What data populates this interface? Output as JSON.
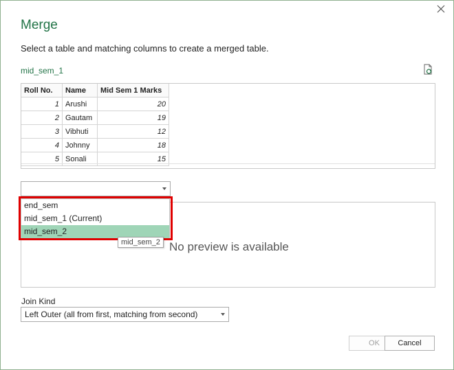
{
  "dialog": {
    "title": "Merge",
    "subtitle": "Select a table and matching columns to create a merged table.",
    "close_icon": "close-icon",
    "refresh_icon": "refresh-icon"
  },
  "first_table": {
    "name": "mid_sem_1",
    "columns": [
      "Roll No.",
      "Name",
      "Mid Sem 1 Marks"
    ],
    "rows": [
      [
        "1",
        "Arushi",
        "20"
      ],
      [
        "2",
        "Gautam",
        "19"
      ],
      [
        "3",
        "Vibhuti",
        "12"
      ],
      [
        "4",
        "Johnny",
        "18"
      ],
      [
        "5",
        "Sonali",
        "15"
      ]
    ]
  },
  "second_table_select": {
    "value": "",
    "options": [
      "end_sem",
      "mid_sem_1 (Current)",
      "mid_sem_2"
    ],
    "highlighted_option": "mid_sem_2",
    "tooltip": "mid_sem_2"
  },
  "second_preview": {
    "message": "No preview is available"
  },
  "join": {
    "label": "Join Kind",
    "value": "Left Outer (all from first, matching from second)"
  },
  "buttons": {
    "ok": "OK",
    "cancel": "Cancel"
  },
  "colors": {
    "accent": "#217346",
    "selection": "#9fd5b7",
    "highlight_border": "#e00000"
  }
}
